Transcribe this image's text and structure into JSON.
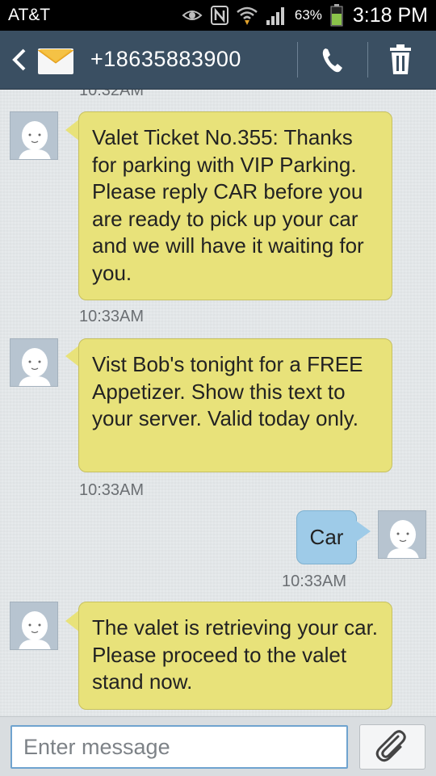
{
  "status_bar": {
    "carrier": "AT&T",
    "battery_percent": "63%",
    "time": "3:18 PM"
  },
  "action_bar": {
    "title": "+18635883900"
  },
  "conversation": {
    "top_timestamp": "10:32AM",
    "messages": [
      {
        "direction": "incoming",
        "text": "Valet Ticket No.355: Thanks for parking with VIP Parking. Please reply CAR before you are ready to pick up your car and we will have it waiting for you.",
        "time": "10:33AM"
      },
      {
        "direction": "incoming",
        "text": "Vist Bob's tonight for a FREE Appetizer. Show this text to your server. Valid today only.",
        "time": "10:33AM"
      },
      {
        "direction": "outgoing",
        "text": "Car",
        "time": "10:33AM"
      },
      {
        "direction": "incoming",
        "text": "The valet is retrieving your car. Please proceed to the valet stand now."
      }
    ]
  },
  "compose": {
    "placeholder": "Enter message"
  },
  "colors": {
    "incoming_bubble": "#e8e27a",
    "outgoing_bubble": "#9ecbe8",
    "action_bar": "#3a4f62"
  },
  "icons": [
    "eye-icon",
    "nfc-icon",
    "wifi-icon",
    "signal-icon",
    "battery-icon",
    "back-icon",
    "envelope-icon",
    "phone-icon",
    "trash-icon",
    "avatar-icon",
    "paperclip-icon"
  ]
}
